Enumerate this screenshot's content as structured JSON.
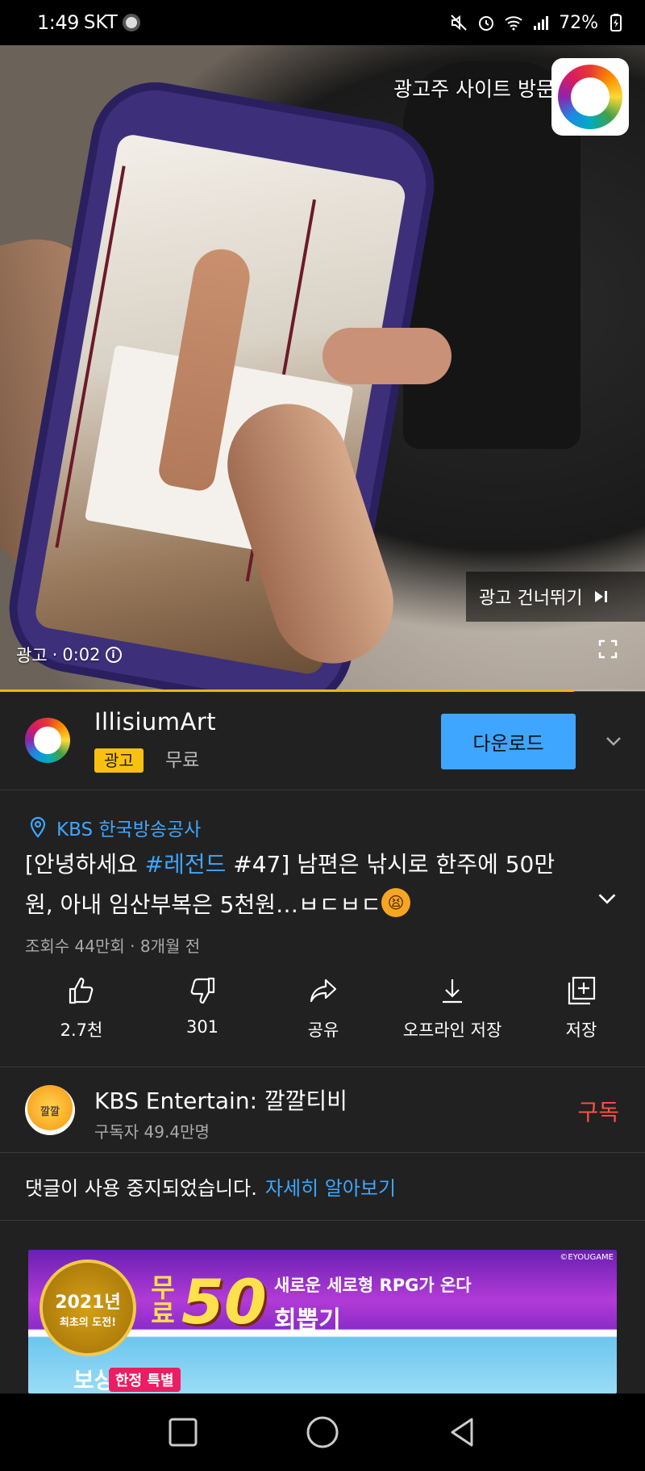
{
  "status_bar": {
    "time": "1:49",
    "carrier": "SKT",
    "battery": "72%"
  },
  "player": {
    "advertiser_site": "광고주 사이트 방문",
    "skip_label": "광고 건너뛰기",
    "ad_label": "광고",
    "ad_time": "0:02",
    "ad_progress": 0.89
  },
  "ad_banner": {
    "app_name": "IllisiumArt",
    "badge": "광고",
    "price": "무료",
    "download_label": "다운로드"
  },
  "video": {
    "location": "KBS 한국방송공사",
    "title_part1": "[안녕하세요 ",
    "title_hashtag": "#레전드",
    "title_part2": " #47] 남편은 낚시로 한주에 50만원, 아내 임산부복은 5천원…ㅂㄷㅂㄷ",
    "emoji": "😫",
    "meta": "조회수 44만회 · 8개월 전"
  },
  "actions": [
    {
      "label": "2.7천"
    },
    {
      "label": "301"
    },
    {
      "label": "공유"
    },
    {
      "label": "오프라인 저장"
    },
    {
      "label": "저장"
    }
  ],
  "channel": {
    "avatar_text": "깔깔",
    "name": "KBS Entertain: 깔깔티비",
    "subscribers": "구독자 49.4만명",
    "subscribe_label": "구독"
  },
  "comments": {
    "text": "댓글이 사용 중지되었습니다.",
    "link": "자세히 알아보기"
  },
  "promo_banner": {
    "copyright": "©EYOUGAME",
    "year": "2021년",
    "year_sub": "최초의 도전!",
    "free": "무료",
    "number": "50",
    "subtitle": "새로운 세로형 RPG가 온다",
    "gacha": "회뽑기",
    "limited": "한정 특별",
    "bo": "보상"
  },
  "colors": {
    "accent_blue": "#3ea6ff",
    "ad_yellow": "#f9c10f",
    "subscribe_red": "#ff4e45",
    "progress": "#f4b400"
  }
}
